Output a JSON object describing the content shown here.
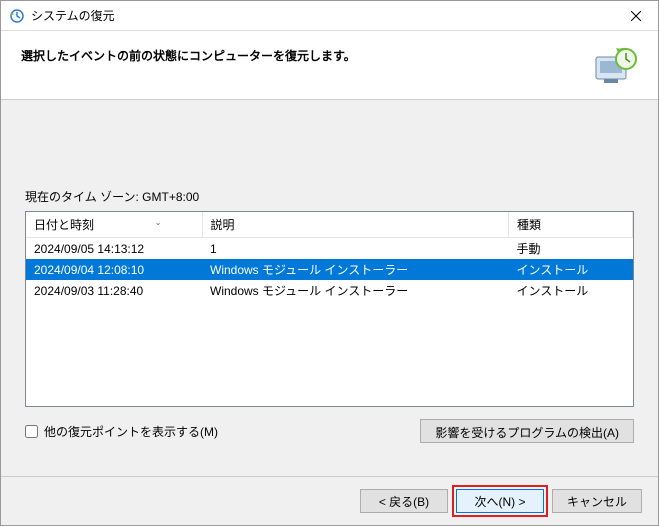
{
  "window": {
    "title": "システムの復元"
  },
  "header": {
    "headline": "選択したイベントの前の状態にコンピューターを復元します。"
  },
  "content": {
    "timezone_label": "現在のタイム ゾーン: GMT+8:00",
    "columns": {
      "date": "日付と時刻",
      "desc": "説明",
      "type": "種類"
    },
    "rows": [
      {
        "date": "2024/09/05 14:13:12",
        "desc": "1",
        "type": "手動",
        "selected": false
      },
      {
        "date": "2024/09/04 12:08:10",
        "desc": "Windows モジュール インストーラー",
        "type": "インストール",
        "selected": true
      },
      {
        "date": "2024/09/03 11:28:40",
        "desc": "Windows モジュール インストーラー",
        "type": "インストール",
        "selected": false
      }
    ],
    "show_more_label": "他の復元ポイントを表示する(M)",
    "scan_label": "影響を受けるプログラムの検出(A)"
  },
  "footer": {
    "back": "< 戻る(B)",
    "next": "次へ(N) >",
    "cancel": "キャンセル"
  }
}
